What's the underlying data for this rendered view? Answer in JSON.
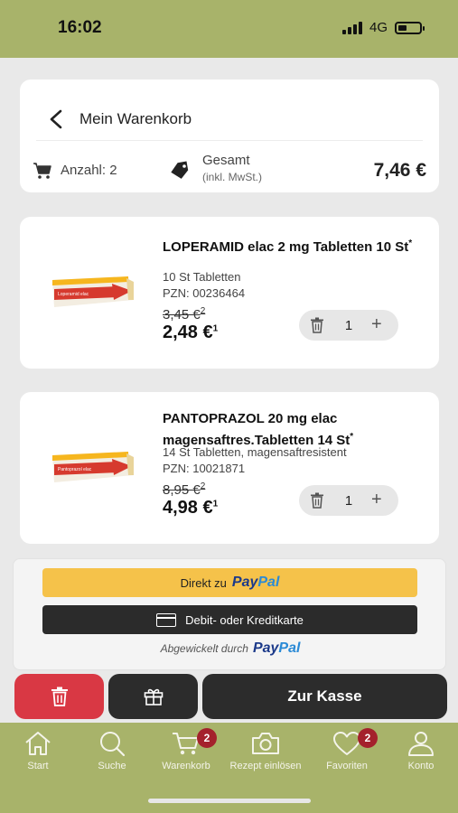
{
  "status_bar": {
    "time": "16:02",
    "network": "4G"
  },
  "cart_header": {
    "title": "Mein Warenkorb",
    "count_label": "Anzahl: 2",
    "total_label": "Gesamt",
    "total_note": "(inkl. MwSt.)",
    "total_amount": "7,46 €"
  },
  "products": [
    {
      "name": "LOPERAMID elac 2 mg Tabletten 10 St",
      "name_mark": "*",
      "pack_text": "Loperamid elac",
      "description": "10 St Tabletten",
      "pzn": "PZN: 00236464",
      "old_price": "3,45 €",
      "old_price_note": "2",
      "price": "2,48 €",
      "price_note": "1",
      "quantity": "1"
    },
    {
      "name": "PANTOPRAZOL 20 mg elac magensaftres.Tabletten 14 St",
      "name_mark": "*",
      "pack_text": "Pantoprazol elac",
      "description": "14 St Tabletten, magensaftresistent",
      "pzn": "PZN: 10021871",
      "old_price": "8,95 €",
      "old_price_note": "2",
      "price": "4,98 €",
      "price_note": "1",
      "quantity": "1"
    }
  ],
  "payment": {
    "paypal_prefix": "Direkt zu",
    "paypal_pay": "Pay",
    "paypal_pal": "Pal",
    "card_label": "Debit- oder Kreditkarte",
    "processed_by": "Abgewickelt durch"
  },
  "actions": {
    "checkout_label": "Zur Kasse"
  },
  "tabbar": {
    "items": [
      {
        "label": "Start",
        "icon": "home-icon"
      },
      {
        "label": "Suche",
        "icon": "search-icon"
      },
      {
        "label": "Warenkorb",
        "icon": "cart-icon",
        "badge": "2"
      },
      {
        "label": "Rezept einlösen",
        "icon": "camera-icon"
      },
      {
        "label": "Favoriten",
        "icon": "heart-icon",
        "badge": "2"
      },
      {
        "label": "Konto",
        "icon": "user-icon"
      }
    ]
  },
  "colors": {
    "brand_green": "#a8b36a",
    "delete_red": "#d93844",
    "badge_red": "#a4212c",
    "paypal_yellow": "#f5c24a",
    "dark_button": "#2c2c2c"
  }
}
